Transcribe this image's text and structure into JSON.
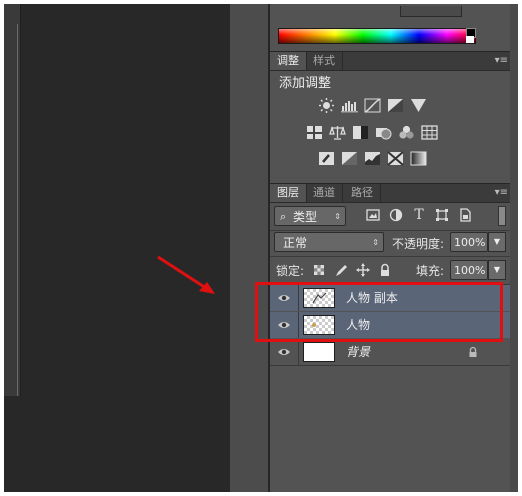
{
  "adjustments_panel": {
    "tabs": [
      {
        "label": "调整"
      },
      {
        "label": "样式"
      }
    ],
    "title": "添加调整",
    "menu_icon": "panel-menu-icon"
  },
  "layers_panel": {
    "tabs": [
      {
        "label": "图层"
      },
      {
        "label": "通道"
      },
      {
        "label": "路径"
      }
    ],
    "filter": {
      "label": "类型",
      "icon": "search-icon"
    },
    "blend_mode": "正常",
    "opacity": {
      "label": "不透明度:",
      "value": "100%"
    },
    "lock": {
      "label": "锁定:"
    },
    "fill": {
      "label": "填充:",
      "value": "100%"
    },
    "layers": [
      {
        "name": "人物 副本",
        "selected": true
      },
      {
        "name": "人物",
        "selected": true
      },
      {
        "name": "背景",
        "selected": false,
        "locked": true
      }
    ]
  },
  "colors": {
    "highlight": "#e01010",
    "selected_row": "#5a6577",
    "panel_bg": "#535353",
    "canvas_bg": "#282828"
  }
}
